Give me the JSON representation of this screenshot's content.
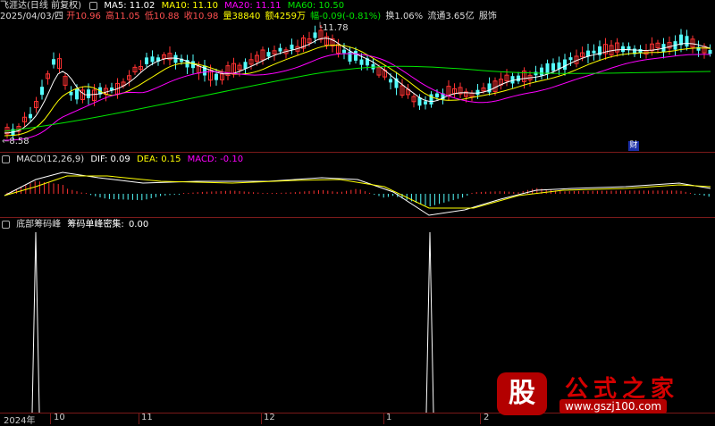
{
  "header": {
    "title": "飞涯达(日线 前复权)",
    "ma5": "MA5: 11.02",
    "ma10": "MA10: 11.10",
    "ma20": "MA20: 11.11",
    "ma60": "MA60: 10.50"
  },
  "quote": {
    "date": "2025/04/03/四",
    "open": "开10.96",
    "high": "高11.05",
    "low": "低10.88",
    "close": "收10.98",
    "volume": "量38840",
    "amount": "额4259万",
    "change": "幅-0.09(-0.81%)",
    "turnover": "换1.06%",
    "float_value": "流通3.65亿",
    "sector": "服饰"
  },
  "price_panel": {
    "high_marker": "11.78",
    "low_marker": "8.58",
    "event_badge": "财"
  },
  "macd_panel": {
    "title": "MACD(12,26,9)",
    "dif": "DIF: 0.09",
    "dea": "DEA: 0.15",
    "macd": "MACD: -0.10"
  },
  "indicator_panel": {
    "title": "底部筹码峰",
    "line_name": "筹码单峰密集:",
    "value": "0.00"
  },
  "xaxis": {
    "labels": [
      "2024年",
      "10",
      "11",
      "12",
      "1",
      "2"
    ]
  },
  "colors": {
    "up": "#ff3232",
    "down": "#54fcfc",
    "ma5": "#ffffff",
    "ma10": "#ffff00",
    "ma20": "#ff00ff",
    "ma60": "#00e600",
    "separator": "#7a1a1a"
  },
  "watermark": {
    "badge": "股",
    "title": "公式之家",
    "url": "www.gszj100.com"
  }
}
